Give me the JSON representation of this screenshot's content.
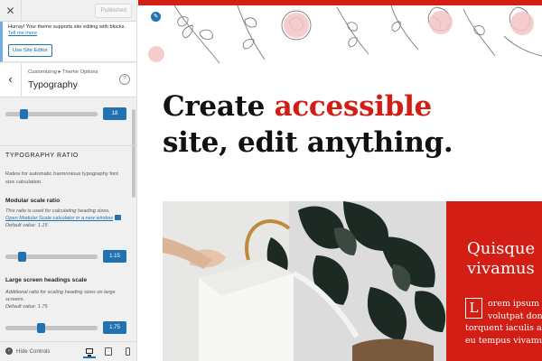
{
  "topbar": {
    "close_icon": "close-icon",
    "published_label": "Published"
  },
  "notice": {
    "text": "Hurray! Your theme supports site editing with blocks.",
    "link_label": "Tell me more",
    "button_label": "Use Site Editor"
  },
  "section": {
    "breadcrumb": "Customizing ▸ Theme Options",
    "title": "Typography",
    "back_icon": "chevron-left-icon",
    "help_icon": "help-icon"
  },
  "controls": {
    "base_size": {
      "value": "18",
      "fraction": 0.2
    },
    "group_title": "Typography Ratio",
    "group_desc": "Ratios for automatic harmonious typography font size calculation.",
    "modular": {
      "label": "Modular scale ratio",
      "desc": "This ratio is used for calculating heading sizes.",
      "link_label": "Open Modular Scale calculator in a new window",
      "default": "Default value: 1.15",
      "value": "1.15",
      "fraction": 0.18
    },
    "large": {
      "label": "Large screen headings scale",
      "desc": "Additional ratio for scaling heading sizes on large screens.",
      "default": "Default value: 1.75",
      "value": "1.75",
      "fraction": 0.38
    }
  },
  "footer": {
    "hide_label": "Hide Controls",
    "devices": [
      "desktop-icon",
      "tablet-icon",
      "mobile-icon"
    ]
  },
  "preview": {
    "headline_1": "Create",
    "headline_accent": "accessible",
    "headline_2": "site, edit anything.",
    "quote_1": "Quisque",
    "quote_2": "vivamus",
    "dropcap": "L",
    "body_lines": [
      "orem ipsum do",
      "volutpat done",
      "torquent iaculis a",
      "eu tempus vivamus"
    ],
    "colors": {
      "accent": "#d31e16",
      "highlight": "#f6d4d2",
      "wp_blue": "#2271b1"
    }
  }
}
